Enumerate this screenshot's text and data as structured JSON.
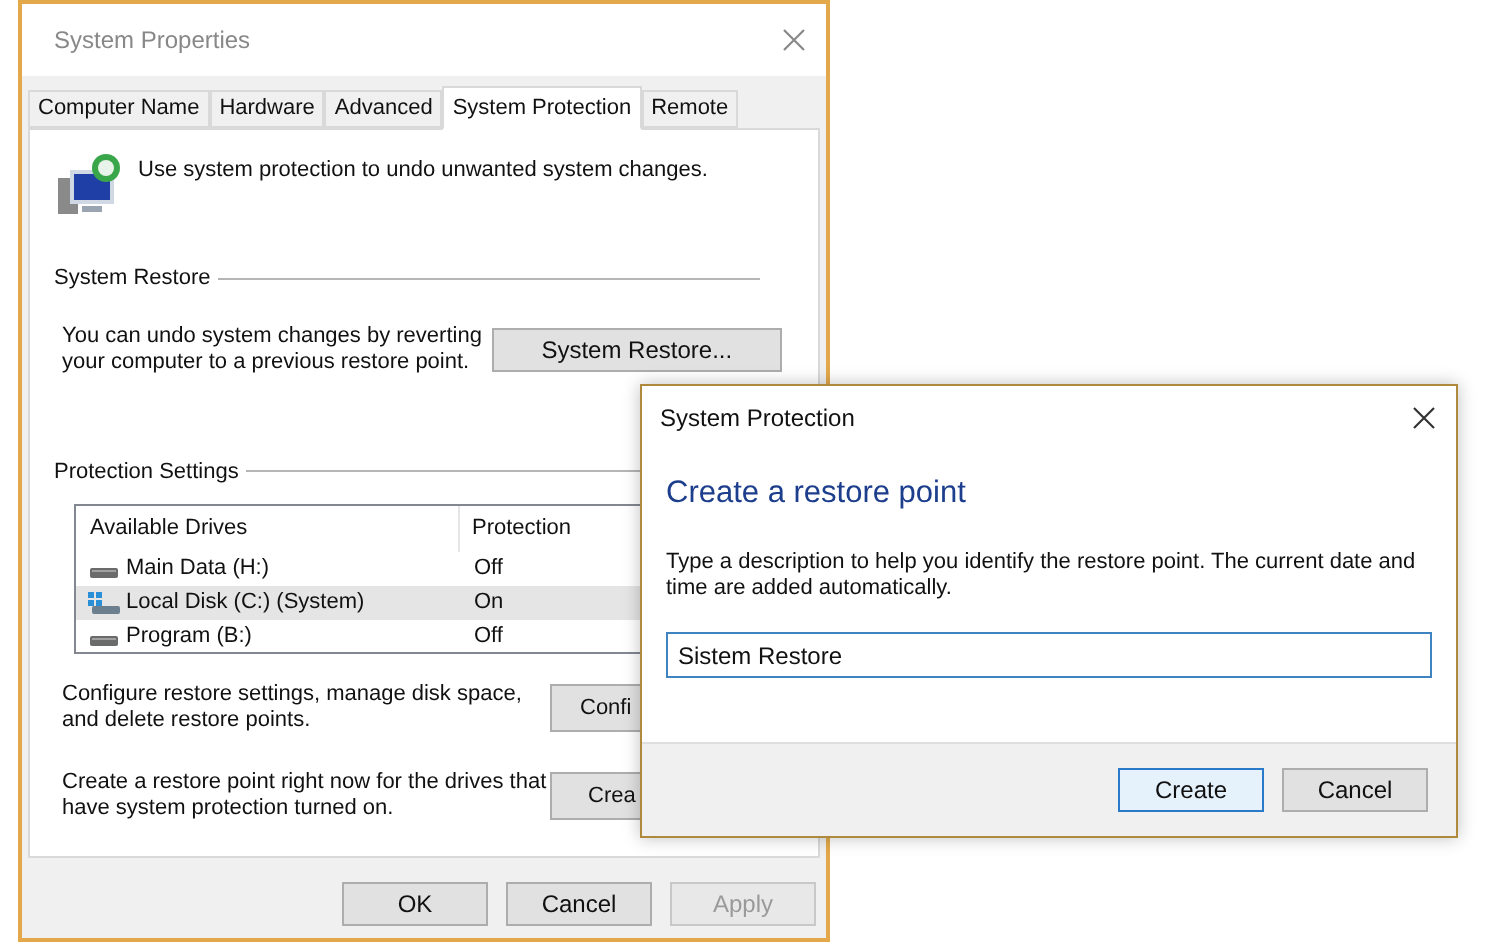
{
  "window": {
    "title": "System Properties"
  },
  "tabs": [
    {
      "label": "Computer Name",
      "selected": false
    },
    {
      "label": "Hardware",
      "selected": false
    },
    {
      "label": "Advanced",
      "selected": false
    },
    {
      "label": "System Protection",
      "selected": true
    },
    {
      "label": "Remote",
      "selected": false
    }
  ],
  "intro": "Use system protection to undo unwanted system changes.",
  "system_restore": {
    "heading": "System Restore",
    "description": "You can undo system changes by reverting your computer to a previous restore point.",
    "button": "System Restore..."
  },
  "protection_settings": {
    "heading": "Protection Settings",
    "columns": [
      "Available Drives",
      "Protection"
    ],
    "rows": [
      {
        "drive": "Main Data (H:)",
        "protection": "Off",
        "kind": "data",
        "selected": false
      },
      {
        "drive": "Local Disk (C:) (System)",
        "protection": "On",
        "kind": "system",
        "selected": true
      },
      {
        "drive": "Program (B:)",
        "protection": "Off",
        "kind": "data",
        "selected": false
      }
    ],
    "configure": {
      "description": "Configure restore settings, manage disk space, and delete restore points.",
      "button": "Confi"
    },
    "create": {
      "description": "Create a restore point right now for the drives that have system protection turned on.",
      "button": "Crea"
    }
  },
  "buttons": [
    {
      "label": "OK",
      "disabled": false
    },
    {
      "label": "Cancel",
      "disabled": false
    },
    {
      "label": "Apply",
      "disabled": true
    }
  ],
  "dialog": {
    "title": "System Protection",
    "heading": "Create a restore point",
    "description": "Type a description to help you identify the restore point. The current date and time are added automatically.",
    "input": {
      "value": "Sistem Restore"
    },
    "buttons": [
      {
        "label": "Create",
        "default": true
      },
      {
        "label": "Cancel",
        "default": false
      }
    ]
  }
}
